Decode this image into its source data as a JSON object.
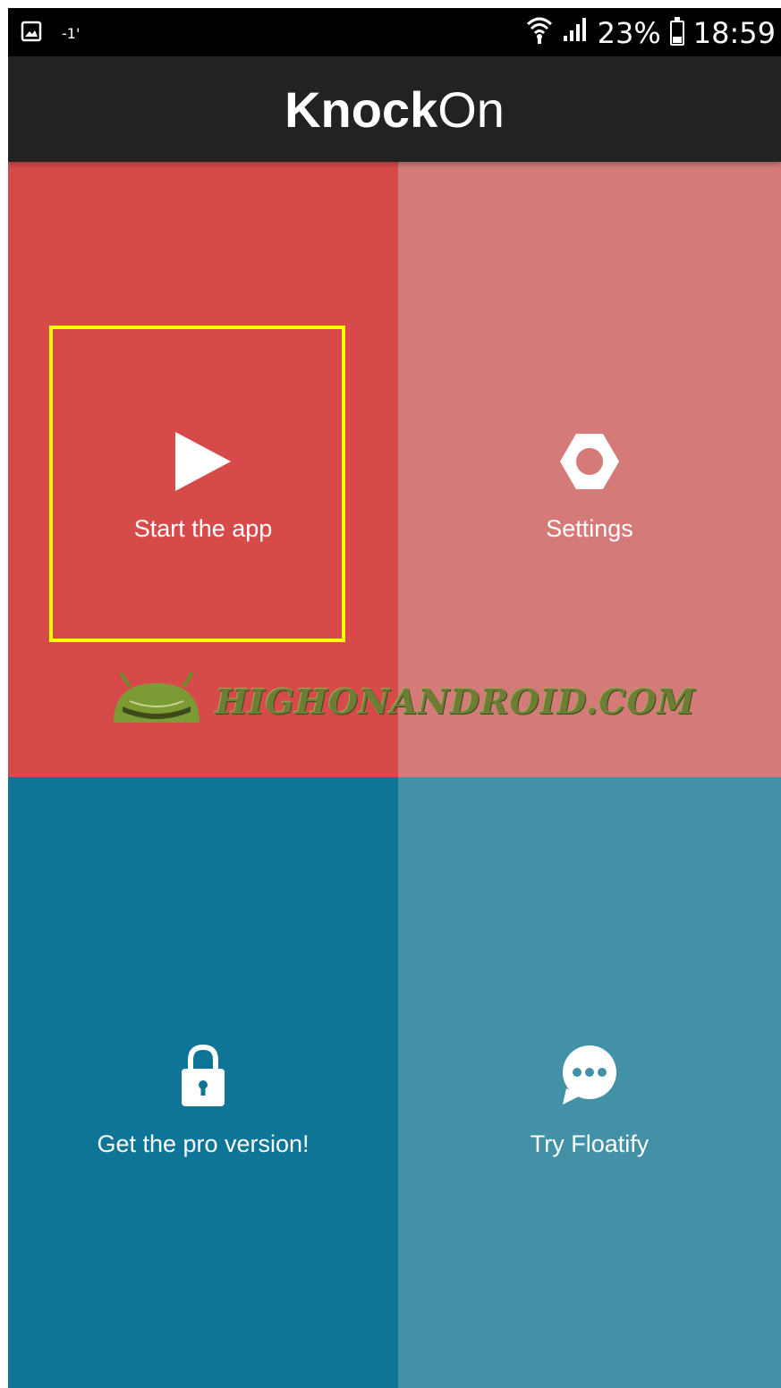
{
  "status_bar": {
    "left_indicator": "-1'",
    "battery": "23%",
    "time": "18:59",
    "icons": [
      "gallery-icon",
      "wifi-icon",
      "signal-icon",
      "battery-icon"
    ]
  },
  "app": {
    "title_bold": "Knock",
    "title_light": "On"
  },
  "tiles": [
    {
      "label": "Start the app",
      "icon": "play-icon",
      "color": "#d64b4a"
    },
    {
      "label": "Settings",
      "icon": "gear-icon",
      "color": "#d47b7a"
    },
    {
      "label": "Get the pro version!",
      "icon": "lock-icon",
      "color": "#0e7596"
    },
    {
      "label": "Try Floatify",
      "icon": "chat-bubble-icon",
      "color": "#4391a7"
    }
  ],
  "watermark": {
    "text": "HIGHONANDROID.COM"
  },
  "colors": {
    "highlight": "#ffff00",
    "title_bar": "#222222"
  }
}
